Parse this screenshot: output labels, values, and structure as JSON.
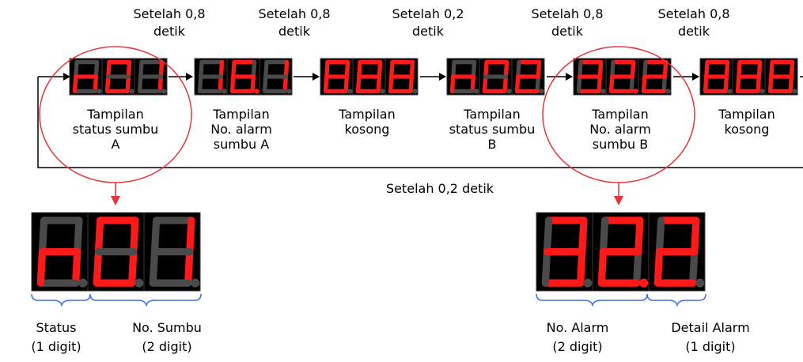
{
  "colors": {
    "segment_on": "#ff1a1a",
    "segment_off": "#4a4a4a",
    "display_bg": "#000000",
    "cell_border": "#3a3a3a",
    "highlight": "#e8333c",
    "brace": "#3a6ee0",
    "line": "#000000"
  },
  "timings": [
    {
      "line1": "Setelah 0,8",
      "line2": "detik"
    },
    {
      "line1": "Setelah 0,8",
      "line2": "detik"
    },
    {
      "line1": "Setelah 0,2",
      "line2": "detik"
    },
    {
      "line1": "Setelah 0,8",
      "line2": "detik"
    },
    {
      "line1": "Setelah 0,8",
      "line2": "detik"
    }
  ],
  "stages": [
    {
      "display": "n01",
      "lines": [
        "Tampilan",
        "status sumbu",
        "A"
      ]
    },
    {
      "display": "16.1",
      "lines": [
        "Tampilan",
        "No. alarm",
        "sumbu A"
      ]
    },
    {
      "display": "888",
      "lines": [
        "Tampilan",
        "kosong"
      ]
    },
    {
      "display": "n02",
      "lines": [
        "Tampilan",
        "status sumbu",
        "B"
      ]
    },
    {
      "display": "32.2",
      "lines": [
        "Tampilan",
        "No. alarm",
        "sumbu B"
      ]
    },
    {
      "display": "888",
      "lines": [
        "Tampilan",
        "kosong"
      ]
    }
  ],
  "loop_label": "Setelah 0,2 detik",
  "detail_left": {
    "display": "n01",
    "groups": [
      {
        "line1": "Status",
        "line2": "(1 digit)"
      },
      {
        "line1": "No. Sumbu",
        "line2": "(2 digit)"
      }
    ]
  },
  "detail_right": {
    "display": "32.2",
    "groups": [
      {
        "line1": "No. Alarm",
        "line2": "(2 digit)"
      },
      {
        "line1": "Detail Alarm",
        "line2": "(1 digit)"
      }
    ]
  }
}
